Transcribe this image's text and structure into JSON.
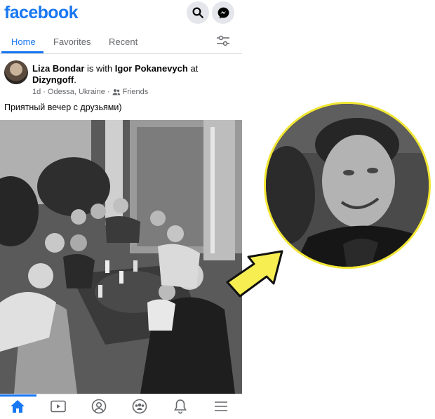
{
  "header": {
    "logo_text": "facebook",
    "search_icon": "search-icon",
    "messenger_icon": "messenger-icon"
  },
  "tabs": [
    {
      "label": "Home",
      "active": true
    },
    {
      "label": "Favorites",
      "active": false
    },
    {
      "label": "Recent",
      "active": false
    }
  ],
  "post": {
    "author": "Liza Bondar",
    "with_text": "is with",
    "tagged": "Igor Pokanevych",
    "at_text": "at",
    "place": "Dizyngoff",
    "time": "1d",
    "location": "Odessa, Ukraine",
    "audience": "Friends",
    "caption": "Приятный вечер с друзьями)"
  },
  "bottom_nav": [
    {
      "icon": "home-icon",
      "active": true
    },
    {
      "icon": "video-icon",
      "active": false
    },
    {
      "icon": "profile-icon",
      "active": false
    },
    {
      "icon": "groups-icon",
      "active": false
    },
    {
      "icon": "bell-icon",
      "active": false
    },
    {
      "icon": "menu-icon",
      "active": false
    }
  ],
  "colors": {
    "brand": "#1877f2",
    "highlight": "#f1e632"
  }
}
